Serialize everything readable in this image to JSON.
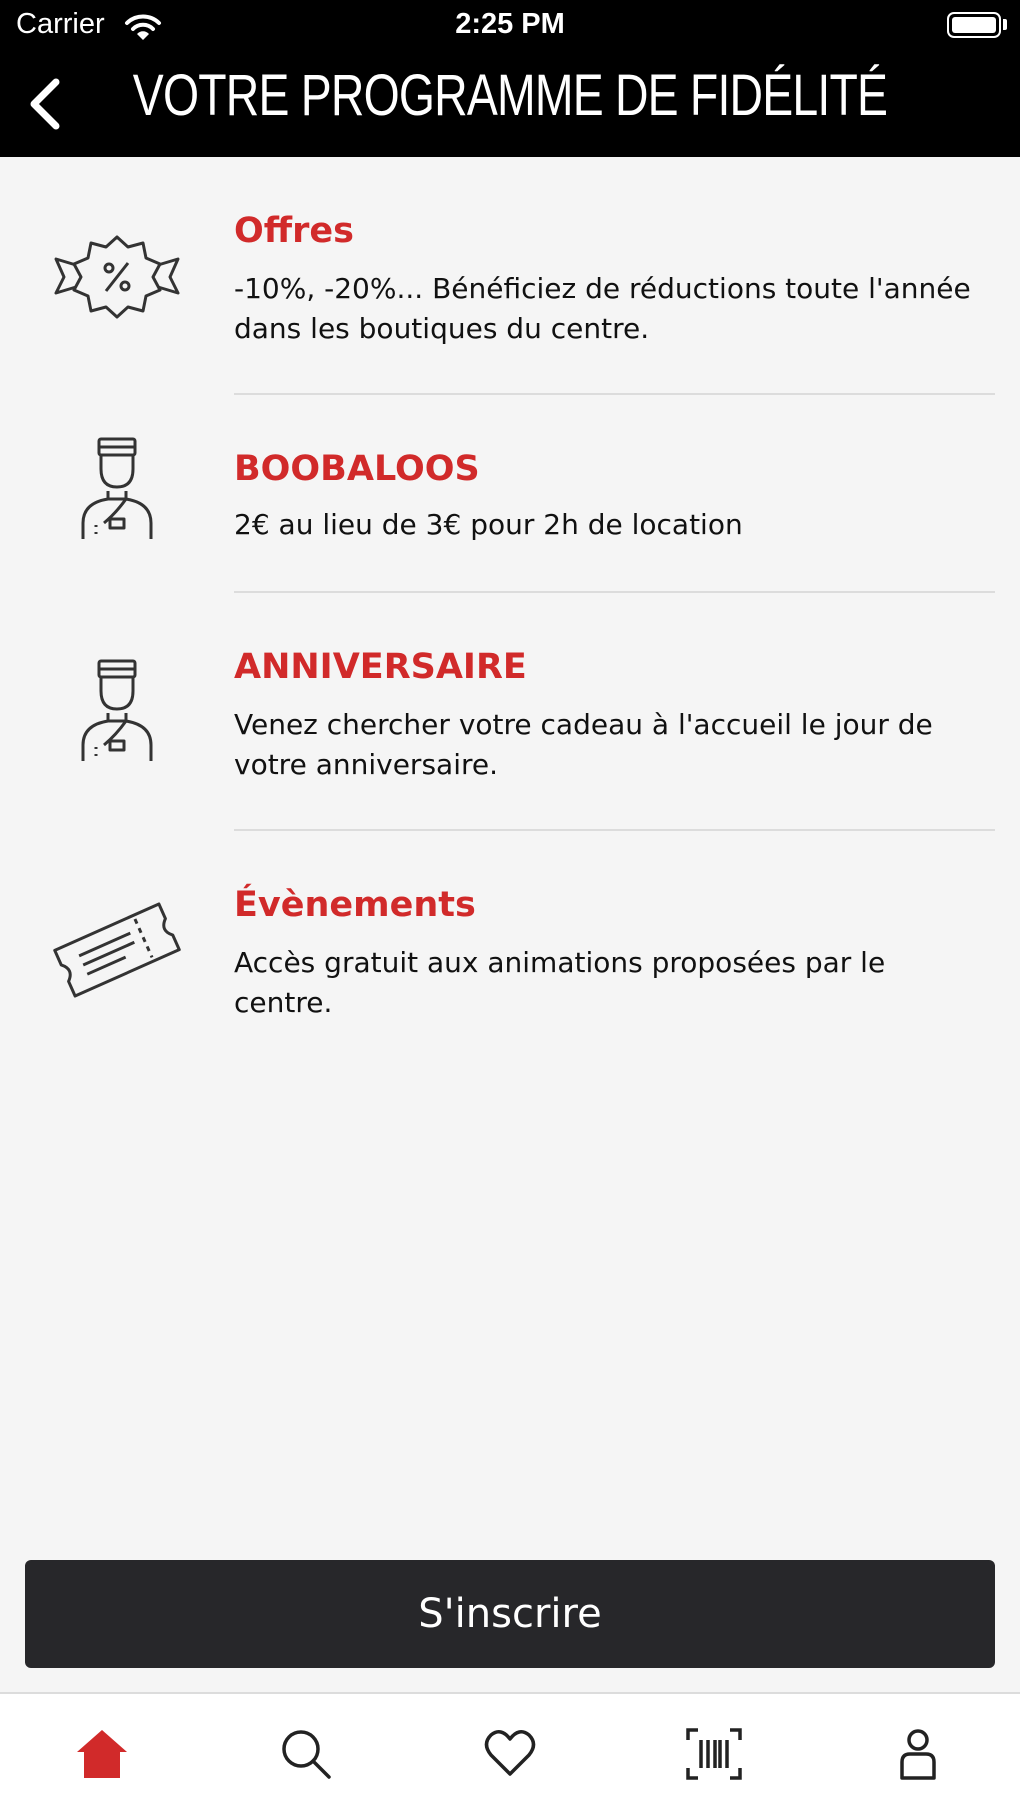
{
  "status_bar": {
    "carrier": "Carrier",
    "time": "2:25 PM"
  },
  "header": {
    "title": "VOTRE PROGRAMME DE FIDÉLITÉ",
    "back_icon": "chevron-left-icon"
  },
  "benefits": [
    {
      "icon": "discount-badge-icon",
      "title": "Offres",
      "description": "-10%, -20%... Bénéficiez de réductions toute l'année dans les boutiques du centre."
    },
    {
      "icon": "concierge-icon",
      "title": "BOOBALOOS",
      "description": "2€ au lieu de 3€ pour 2h de location"
    },
    {
      "icon": "concierge-icon",
      "title": "ANNIVERSAIRE",
      "description": "Venez chercher votre cadeau à l'accueil le jour de votre anniversaire."
    },
    {
      "icon": "ticket-icon",
      "title": "Évènements",
      "description": "Accès gratuit aux animations proposées par le centre."
    }
  ],
  "cta": {
    "label": "S'inscrire"
  },
  "tabbar": {
    "active_tab": "home",
    "items": [
      {
        "id": "home",
        "icon": "home-icon"
      },
      {
        "id": "search",
        "icon": "search-icon"
      },
      {
        "id": "favorites",
        "icon": "heart-icon"
      },
      {
        "id": "scan",
        "icon": "barcode-scan-icon"
      },
      {
        "id": "account",
        "icon": "user-icon"
      }
    ]
  },
  "colors": {
    "accent": "#d12a2a",
    "header_bg": "#000000",
    "cta_bg": "#27272a",
    "page_bg": "#f5f5f5",
    "icon_gray": "#333333"
  }
}
